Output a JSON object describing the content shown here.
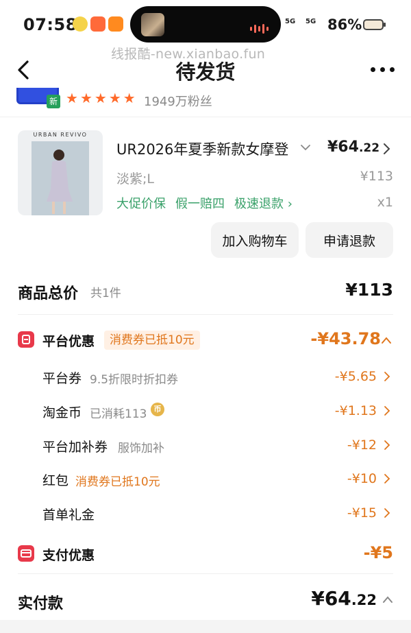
{
  "status": {
    "time": "07:58",
    "net1": "5G",
    "net2": "5G",
    "battery": "86%"
  },
  "watermark": "线报酷-new.xianbao.fun",
  "nav": {
    "title": "待发货"
  },
  "shop": {
    "new_badge": "新",
    "fans": "1949万粉丝"
  },
  "product": {
    "brand": "URBAN REVIVO",
    "title": "UR2026年夏季新款女摩登",
    "price_main": "¥64",
    "price_decimal": ".22",
    "spec": "淡紫;L",
    "original_price": "¥113",
    "service_1": "大促价保",
    "service_2": "假一赔四",
    "service_3": "极速退款 ›",
    "quantity": "x1"
  },
  "actions": {
    "add_cart": "加入购物车",
    "refund": "申请退款"
  },
  "summary": {
    "total_label": "商品总价",
    "total_count": "共1件",
    "total_value": "¥113",
    "platform_label": "平台优惠",
    "platform_tag": "消费券已抵10元",
    "platform_value": "-¥43.78",
    "rows": [
      {
        "label": "平台券",
        "sub": "9.5折限时折扣券",
        "value": "-¥5.65"
      },
      {
        "label": "淘金币",
        "sub": "已消耗113",
        "value": "-¥1.13"
      },
      {
        "label": "平台加补券",
        "sub": "服饰加补",
        "value": "-¥12"
      },
      {
        "label": "红包",
        "sub": "消费券已抵10元",
        "value": "-¥10"
      },
      {
        "label": "首单礼金",
        "sub": "",
        "value": "-¥15"
      }
    ],
    "coin_glyph": "币",
    "pay_label": "支付优惠",
    "pay_value": "-¥5",
    "final_label": "实付款",
    "final_main": "¥64",
    "final_decimal": ".22"
  },
  "colors": {
    "accent_orange": "#e0761c",
    "service_green": "#3aa16a",
    "icon_red": "#e8394a"
  }
}
